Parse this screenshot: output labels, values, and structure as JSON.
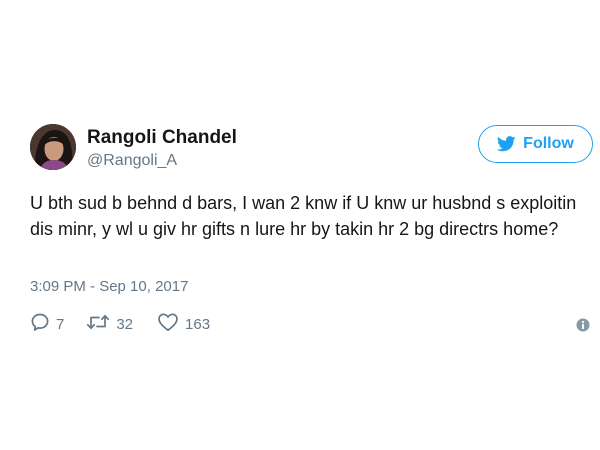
{
  "tweet": {
    "author": {
      "display_name": "Rangoli Chandel",
      "handle": "@Rangoli_A"
    },
    "follow_label": "Follow",
    "text": "U bth sud b behnd d bars, I wan 2 knw if U knw ur husbnd s exploitin dis minr, y wl u giv hr gifts n lure hr by takin hr 2 bg directrs home?",
    "timestamp": "3:09 PM - Sep 10, 2017",
    "stats": {
      "replies": "7",
      "retweets": "32",
      "likes": "163"
    }
  },
  "icons": {
    "follow": "twitter-bird-icon",
    "reply": "reply-bubble-icon",
    "retweet": "retweet-arrows-icon",
    "like": "heart-icon",
    "info": "info-circle-icon"
  },
  "colors": {
    "accent": "#1da1f2",
    "text": "#14171a",
    "secondary": "#657786",
    "background": "#ffffff"
  }
}
